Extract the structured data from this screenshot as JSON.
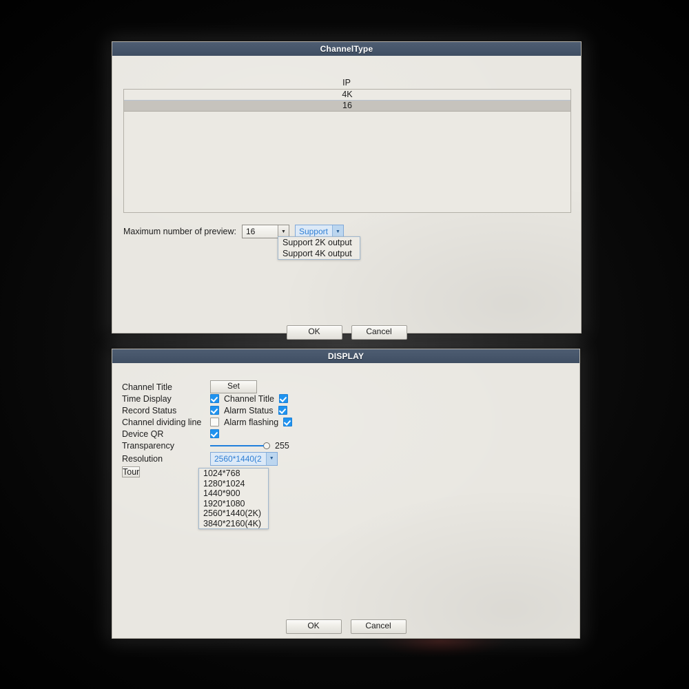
{
  "channel_type_dialog": {
    "title": "ChannelType",
    "table": {
      "header": "IP",
      "rows": [
        {
          "label": "4K",
          "selected": false
        },
        {
          "label": "16",
          "selected": true
        }
      ]
    },
    "preview_label": "Maximum number of preview:",
    "preview_value": "16",
    "output_combo": {
      "value": "Support",
      "options": [
        "Support 2K output",
        "Support 4K output"
      ]
    },
    "ok_label": "OK",
    "cancel_label": "Cancel"
  },
  "display_dialog": {
    "title": "DISPLAY",
    "rows": {
      "channel_title_label": "Channel Title",
      "set_button": "Set",
      "time_display_label": "Time Display",
      "time_display_checked": true,
      "channel_title_check_label": "Channel Title",
      "channel_title_checked": true,
      "record_status_label": "Record Status",
      "record_status_checked": true,
      "alarm_status_label": "Alarm Status",
      "alarm_status_checked": true,
      "channel_dividing_line_label": "Channel dividing line",
      "channel_dividing_line_checked": false,
      "alarm_flashing_label": "Alarm flashing",
      "alarm_flashing_checked": true,
      "device_qr_label": "Device QR",
      "device_qr_checked": true,
      "transparency_label": "Transparency",
      "transparency_value": "255",
      "resolution_label": "Resolution",
      "resolution_value": "2560*1440(2",
      "tour_button": "Tour"
    },
    "resolution_options": [
      "1024*768",
      "1280*1024",
      "1440*900",
      "1920*1080",
      "2560*1440(2K)",
      "3840*2160(4K)"
    ],
    "ok_label": "OK",
    "cancel_label": "Cancel"
  },
  "colors": {
    "titlebar": "#46556a",
    "dialog_bg": "#e9e7e1",
    "checkbox_blue": "#1f93f0",
    "accent_blue": "#2f7fd4",
    "row_highlight": "#c6c3bd"
  }
}
